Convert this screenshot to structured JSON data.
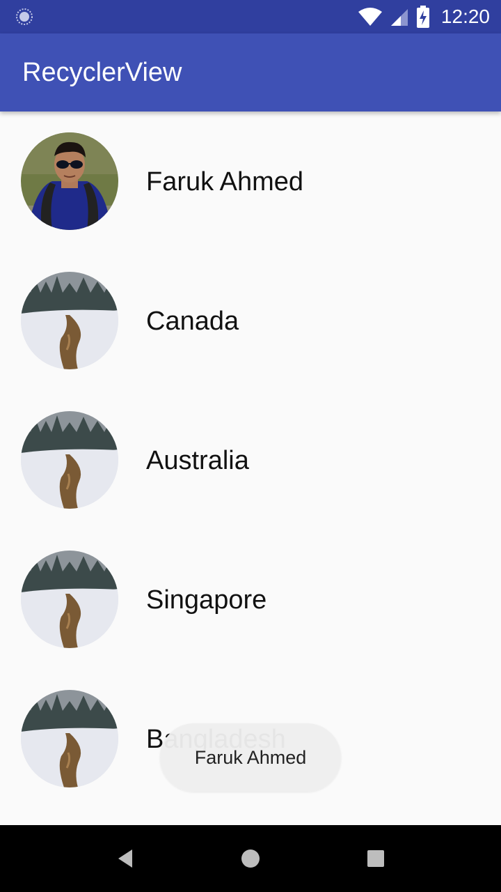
{
  "status_bar": {
    "time": "12:20",
    "icons": [
      "sync-icon",
      "wifi-icon",
      "signal-icon",
      "battery-charging-icon"
    ],
    "background": "#303f9f"
  },
  "app_bar": {
    "title": "RecyclerView",
    "background": "#3f51b5"
  },
  "list": {
    "items": [
      {
        "label": "Faruk Ahmed",
        "image": "person-photo"
      },
      {
        "label": "Canada",
        "image": "snow-landscape-photo"
      },
      {
        "label": "Australia",
        "image": "snow-landscape-photo"
      },
      {
        "label": "Singapore",
        "image": "snow-landscape-photo"
      },
      {
        "label": "Bangladesh",
        "image": "snow-landscape-photo"
      }
    ]
  },
  "toast": {
    "text": "Faruk Ahmed"
  },
  "nav_bar": {
    "buttons": [
      "back-icon",
      "home-icon",
      "recents-icon"
    ]
  }
}
